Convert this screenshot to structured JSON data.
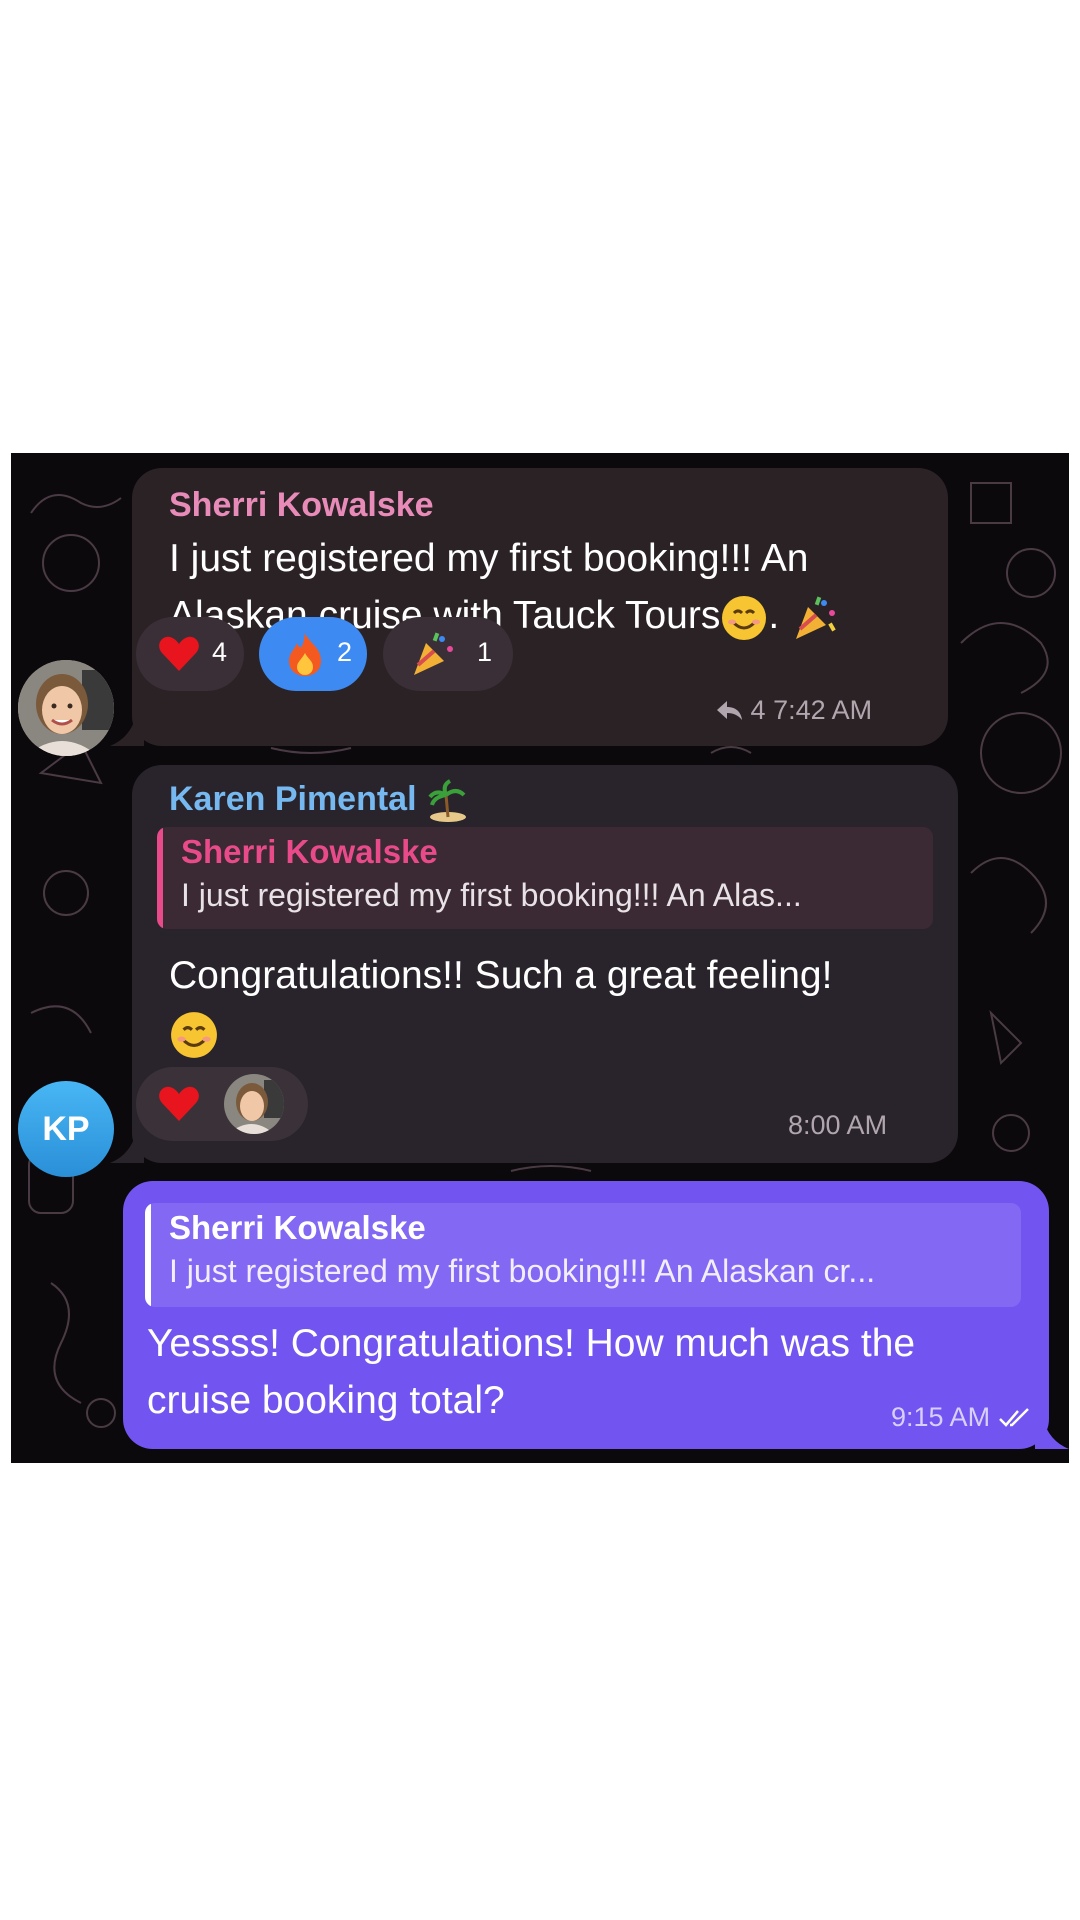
{
  "messages": [
    {
      "sender": "Sherri Kowalske",
      "text": "I just registered my first booking!!!  An Alaskan cruise with Tauck Tours",
      "text_suffix": ".",
      "reactions": [
        {
          "emoji": "red-heart",
          "count": "4"
        },
        {
          "emoji": "fire",
          "count": "2",
          "selected": true
        },
        {
          "emoji": "party-popper",
          "count": "1"
        }
      ],
      "reply_count": "4",
      "time": "7:42 AM"
    },
    {
      "sender": "Karen Pimental",
      "sender_badge": "desert-island-emoji",
      "avatar_initials": "KP",
      "quote": {
        "name": "Sherri Kowalske",
        "text": "I just registered my first booking!!! An Alas..."
      },
      "text": "Congratulations!! Such a great feeling!",
      "reactions": [
        {
          "emoji": "red-heart",
          "by": "sherri-avatar"
        }
      ],
      "time": "8:00 AM"
    },
    {
      "outgoing": true,
      "quote": {
        "name": "Sherri Kowalske",
        "text": "I just registered my first booking!!! An Alaskan cr..."
      },
      "text": "Yessss! Congratulations! How much was the cruise booking total?",
      "time": "9:15 AM",
      "status": "read-double-check"
    }
  ],
  "colors": {
    "chat_background": "#0b090c",
    "incoming_bubble": "#2b2226",
    "outgoing_bubble": "#7254f0",
    "sherri_name": "#e88bb8",
    "karen_name": "#76b8f0",
    "reaction_selected": "#3d8bf2",
    "kp_avatar": "#2f9fe4"
  }
}
